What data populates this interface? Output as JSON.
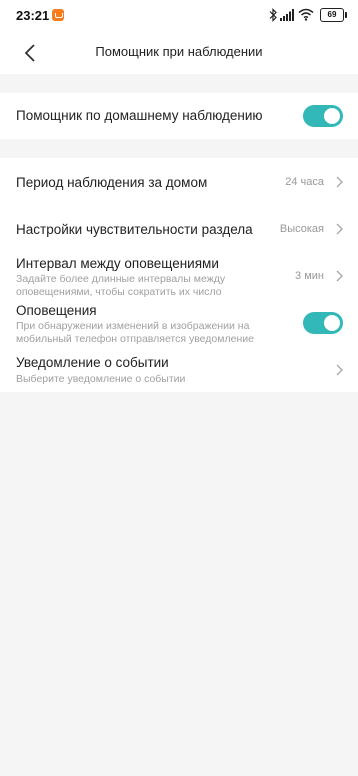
{
  "status_bar": {
    "time": "23:21",
    "battery": "69"
  },
  "header": {
    "title": "Помощник при наблюдении"
  },
  "settings": {
    "home_assistant": {
      "label": "Помощник по домашнему наблюдению",
      "enabled": true
    },
    "items": [
      {
        "title": "Период наблюдения за домом",
        "value": "24 часа"
      },
      {
        "title": "Настройки чувствительности раздела",
        "value": "Высокая"
      },
      {
        "title": "Интервал между оповещениями",
        "description": "Задайте более длинные интервалы между оповещениями, чтобы сократить их число",
        "value": "3 мин"
      },
      {
        "title": "Оповещения",
        "description": "При обнаружении изменений в изображении на мобильный телефон отправляется уведомление",
        "enabled": true
      },
      {
        "title": "Уведомление о событии",
        "description": "Выберите уведомление о событии"
      }
    ]
  },
  "colors": {
    "accent": "#33b8b8",
    "background": "#f5f5f5",
    "card": "#ffffff"
  }
}
